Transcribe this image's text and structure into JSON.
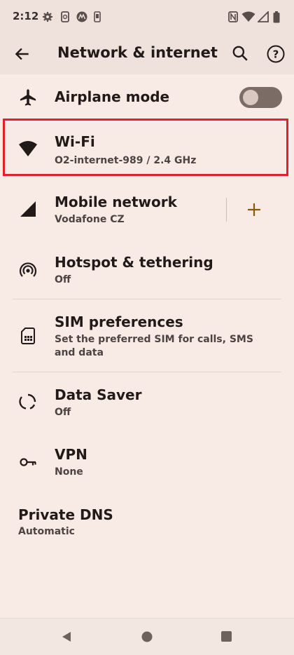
{
  "status_bar": {
    "time": "2:12"
  },
  "app_bar": {
    "title": "Network & internet"
  },
  "settings": [
    {
      "title": "Airplane mode"
    },
    {
      "title": "Wi-Fi",
      "subtitle": "O2-internet-989 / 2.4 GHz"
    },
    {
      "title": "Mobile network",
      "subtitle": "Vodafone CZ"
    },
    {
      "title": "Hotspot & tethering",
      "subtitle": "Off"
    },
    {
      "title": "SIM preferences",
      "subtitle": "Set the preferred SIM for calls, SMS and data"
    },
    {
      "title": "Data Saver",
      "subtitle": "Off"
    },
    {
      "title": "VPN",
      "subtitle": "None"
    },
    {
      "title": "Private DNS",
      "subtitle": "Automatic"
    }
  ],
  "airplane_mode_on": false,
  "colors": {
    "background": "#f8ebe6",
    "highlight": "#e0212b",
    "accent": "#8a5a00"
  }
}
